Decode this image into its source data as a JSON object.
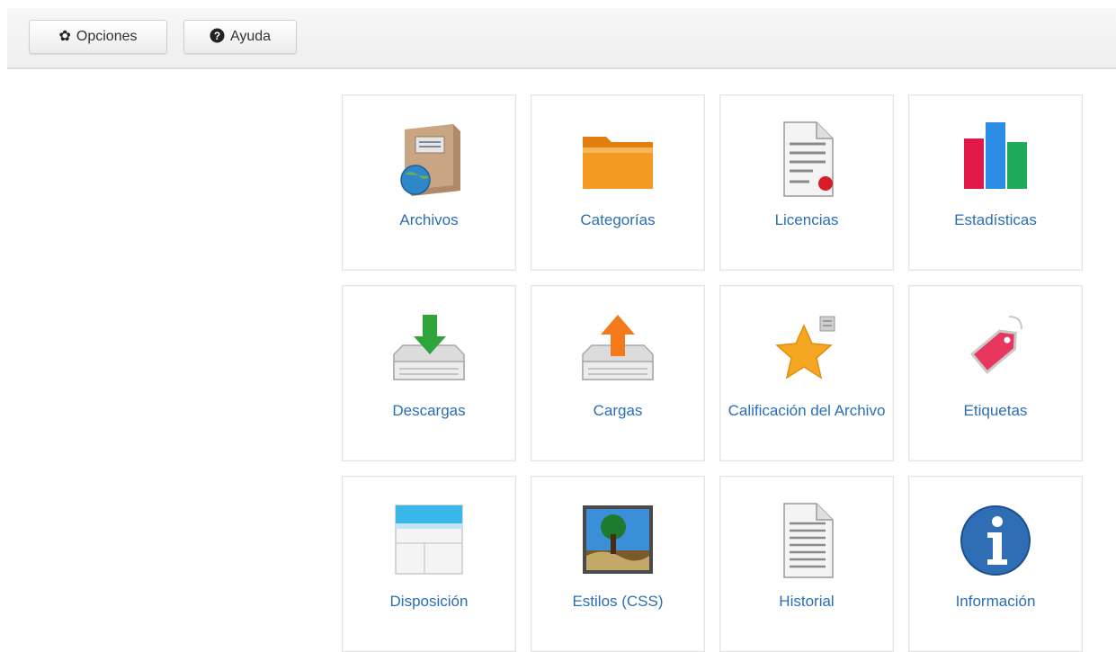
{
  "toolbar": {
    "options_label": "Opciones",
    "help_label": "Ayuda",
    "options_icon": "gear-icon",
    "help_icon": "question-circle-icon"
  },
  "dashboard": {
    "tiles": [
      {
        "label": "Archivos",
        "icon": "files-icon"
      },
      {
        "label": "Categorías",
        "icon": "folder-icon"
      },
      {
        "label": "Licencias",
        "icon": "license-icon"
      },
      {
        "label": "Estadísticas",
        "icon": "bar-chart-icon"
      },
      {
        "label": "Descargas",
        "icon": "download-icon"
      },
      {
        "label": "Cargas",
        "icon": "upload-icon"
      },
      {
        "label": "Calificación del Archivo",
        "icon": "star-rating-icon"
      },
      {
        "label": "Etiquetas",
        "icon": "tag-icon"
      },
      {
        "label": "Disposición",
        "icon": "layout-icon"
      },
      {
        "label": "Estilos (CSS)",
        "icon": "image-styles-icon"
      },
      {
        "label": "Historial",
        "icon": "history-icon"
      },
      {
        "label": "Información",
        "icon": "info-icon"
      }
    ]
  },
  "colors": {
    "link": "#2a6fb3",
    "toolbar_bg": "#f2f2f2"
  }
}
